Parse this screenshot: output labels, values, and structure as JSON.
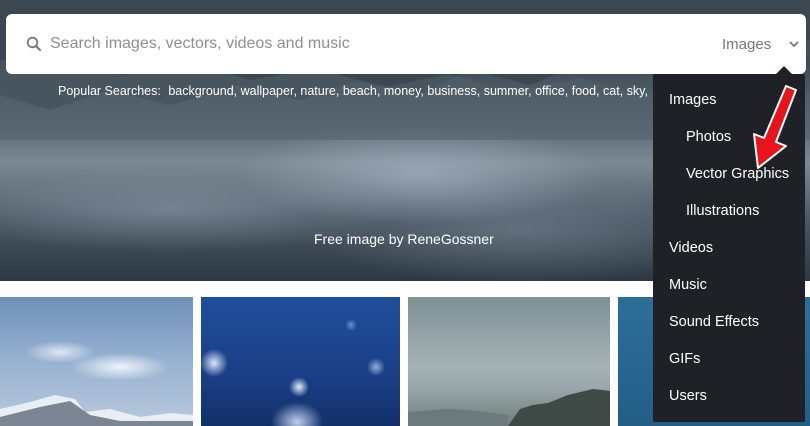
{
  "search": {
    "placeholder": "Search images, vectors, videos and music",
    "type_selected": "Images"
  },
  "popular": {
    "label": "Popular Searches:",
    "terms": [
      "background,",
      "wallpaper,",
      "nature,",
      "beach,",
      "money,",
      "business,",
      "summer,",
      "office,",
      "food,",
      "cat,",
      "sky,"
    ]
  },
  "hero": {
    "credit": "Free image by ReneGossner"
  },
  "dropdown": {
    "items": [
      {
        "label": "Images",
        "level": "top"
      },
      {
        "label": "Photos",
        "level": "sub"
      },
      {
        "label": "Vector Graphics",
        "level": "sub"
      },
      {
        "label": "Illustrations",
        "level": "sub"
      },
      {
        "label": "Videos",
        "level": "top"
      },
      {
        "label": "Music",
        "level": "top"
      },
      {
        "label": "Sound Effects",
        "level": "top"
      },
      {
        "label": "GIFs",
        "level": "top"
      },
      {
        "label": "Users",
        "level": "top"
      }
    ]
  },
  "colors": {
    "dropdown_bg": "#1f2127",
    "annotation_arrow": "#e8141c",
    "search_bg": "#ffffff"
  },
  "icons": {
    "search": "search-icon",
    "type_select": "chevron-down-icon",
    "annotation": "red-arrow-icon"
  }
}
